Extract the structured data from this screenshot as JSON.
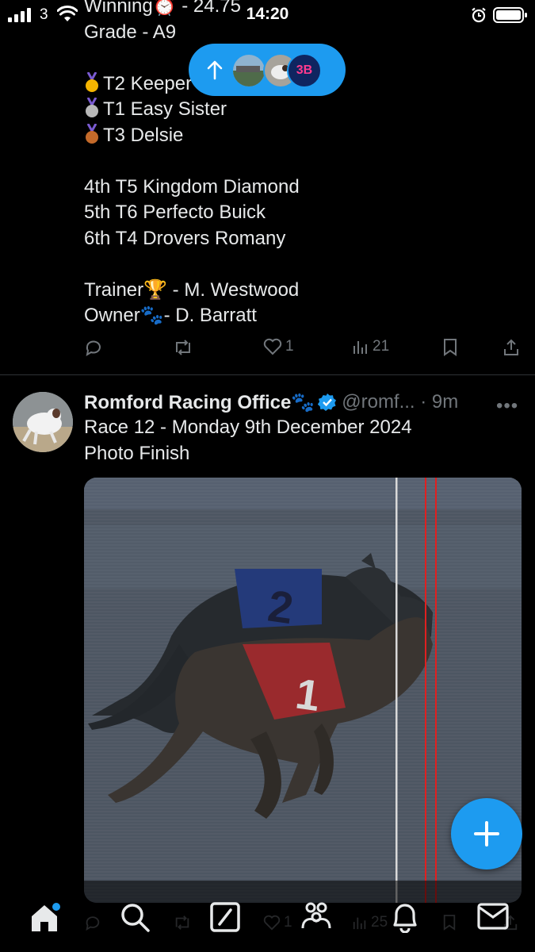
{
  "status_bar": {
    "carrier": "3",
    "time": "14:20"
  },
  "new_posts_pill": {
    "avatar3_text": "3B"
  },
  "tweet1": {
    "line_winning": "Winning⏰ - 24.75",
    "line_grade": "Grade - A9",
    "podium": [
      {
        "medal": "gold-medal-icon",
        "text": "T2 Keeper"
      },
      {
        "medal": "silver-medal-icon",
        "text": "T1 Easy Sister"
      },
      {
        "medal": "bronze-medal-icon",
        "text": "T3 Delsie"
      }
    ],
    "placings": [
      "4th T5 Kingdom Diamond",
      "5th T6 Perfecto Buick",
      "6th T4 Drovers Romany"
    ],
    "trainer": "Trainer🏆 - M. Westwood",
    "owner": "Owner🐾- D. Barratt",
    "likes": "1",
    "views": "21"
  },
  "tweet2": {
    "name": "Romford Racing Office🐾",
    "handle": "@romf... · 9m",
    "line1": "Race 12 - Monday 9th December 2024",
    "line2": "Photo Finish",
    "likes": "1",
    "views": "25"
  },
  "colors": {
    "accent": "#1d9bf0",
    "muted": "#71767b",
    "text": "#e7e9ea",
    "background": "#000000"
  }
}
